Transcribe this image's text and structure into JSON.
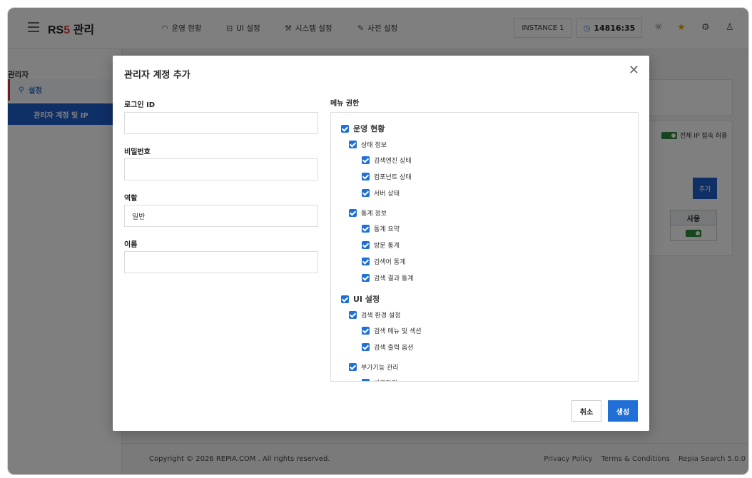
{
  "header": {
    "logo_prefix": "RS",
    "logo_number": "5",
    "logo_suffix": "관리",
    "nav": [
      {
        "icon": "gauge-icon",
        "label": "운영 현황"
      },
      {
        "icon": "layout-icon",
        "label": "UI 설정"
      },
      {
        "icon": "wrench-icon",
        "label": "시스템 설정"
      },
      {
        "icon": "edit-icon",
        "label": "사전 설정"
      }
    ],
    "instance": "INSTANCE 1",
    "clock": "14816:35"
  },
  "sidebar": {
    "title": "관리자",
    "item": "설정",
    "subitem": "관리자 계정 및 IP"
  },
  "background": {
    "toggle_label": "전체 IP 접속 허용",
    "add_button": "추가",
    "column_header": "사용"
  },
  "footer": {
    "copyright": "Copyright © 2026 REPIA.COM . All rights reserved.",
    "links": [
      "Privacy Policy",
      "Terms & Conditions",
      "Repia Search 5.0.0"
    ]
  },
  "modal": {
    "title": "관리자 계정 추가",
    "fields": {
      "login_id": {
        "label": "로그인 ID",
        "value": ""
      },
      "password": {
        "label": "비밀번호",
        "value": ""
      },
      "role": {
        "label": "역할",
        "value": "일반"
      },
      "name": {
        "label": "이름",
        "value": ""
      }
    },
    "permissions_label": "메뉴 권한",
    "permissions": [
      {
        "level": 0,
        "label": "운영 현황",
        "checked": true
      },
      {
        "level": 1,
        "label": "상태 정보",
        "checked": true
      },
      {
        "level": 2,
        "label": "검색엔진 상태",
        "checked": true
      },
      {
        "level": 2,
        "label": "컴포넌트 상태",
        "checked": true
      },
      {
        "level": 2,
        "label": "서버 상태",
        "checked": true
      },
      {
        "level": 1,
        "label": "통계 정보",
        "checked": true
      },
      {
        "level": 2,
        "label": "통계 요약",
        "checked": true
      },
      {
        "level": 2,
        "label": "방문 통계",
        "checked": true
      },
      {
        "level": 2,
        "label": "검색어 통계",
        "checked": true
      },
      {
        "level": 2,
        "label": "검색 결과 통계",
        "checked": true
      },
      {
        "level": 0,
        "label": "UI 설정",
        "checked": true
      },
      {
        "level": 1,
        "label": "검색 환경 설정",
        "checked": true
      },
      {
        "level": 2,
        "label": "검색 메뉴 및 섹션",
        "checked": true
      },
      {
        "level": 2,
        "label": "검색 출력 옵션",
        "checked": true
      },
      {
        "level": 1,
        "label": "부가기능 관리",
        "checked": true
      },
      {
        "level": 2,
        "label": "바로가기",
        "checked": true
      }
    ],
    "cancel_label": "취소",
    "create_label": "생성"
  }
}
